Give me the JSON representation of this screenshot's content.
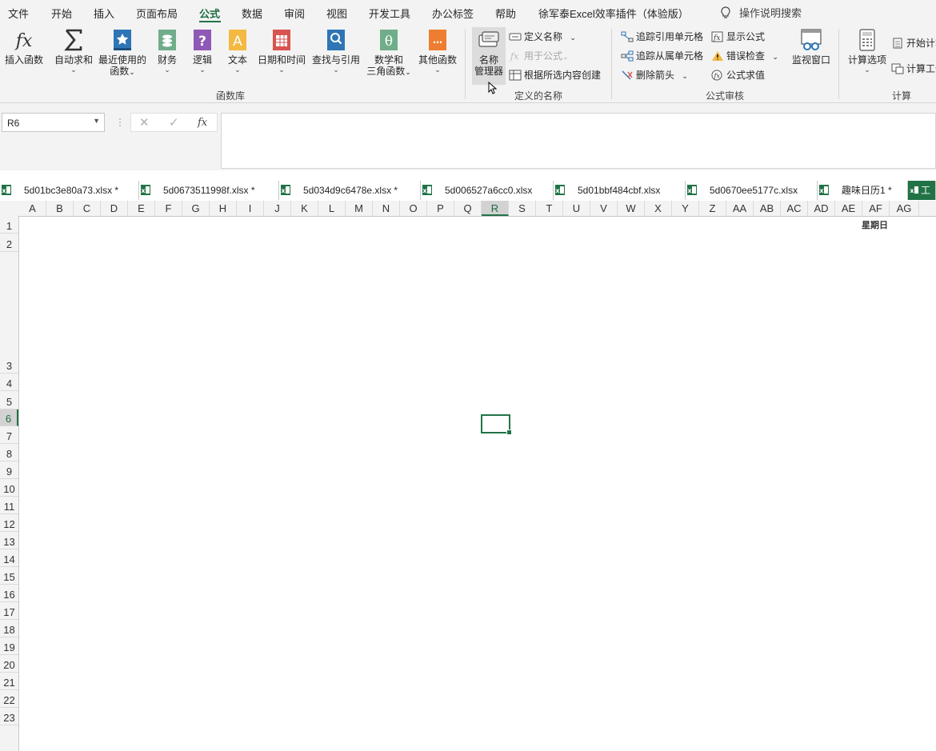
{
  "menu": {
    "items": [
      "文件",
      "开始",
      "插入",
      "页面布局",
      "公式",
      "数据",
      "审阅",
      "视图",
      "开发工具",
      "办公标签",
      "帮助",
      "徐军泰Excel效率插件（体验版）"
    ],
    "active": "公式",
    "tell_me": "操作说明搜索"
  },
  "ribbon": {
    "function_library": {
      "label": "函数库",
      "insert_function": "插入函数",
      "autosum": "自动求和",
      "recently_used": [
        "最近使用的",
        "函数"
      ],
      "financial": "财务",
      "logical": "逻辑",
      "text": "文本",
      "date_time": "日期和时间",
      "lookup": "查找与引用",
      "math": [
        "数学和",
        "三角函数"
      ],
      "more": "其他函数"
    },
    "defined_names": {
      "label": "定义的名称",
      "name_manager": [
        "名称",
        "管理器"
      ],
      "define_name": "定义名称",
      "use_in_formula": "用于公式",
      "create_from_selection": "根据所选内容创建"
    },
    "formula_auditing": {
      "label": "公式审核",
      "trace_precedents": "追踪引用单元格",
      "trace_dependents": "追踪从属单元格",
      "remove_arrows": "删除箭头",
      "show_formulas": "显示公式",
      "error_checking": "错误检查",
      "evaluate_formula": "公式求值",
      "watch_window": "监视窗口"
    },
    "calculation": {
      "label": "计算",
      "calc_options": "计算选项",
      "calc_now": "开始计算",
      "calc_sheet": "计算工作表"
    }
  },
  "formula_bar": {
    "name_box": "R6",
    "fx": "fx",
    "formula": ""
  },
  "workbook_tabs": [
    "5d01bc3e80a73.xlsx *",
    "5d0673511998f.xlsx *",
    "5d034d9c6478e.xlsx *",
    "5d006527a6cc0.xlsx",
    "5d01bbf484cbf.xlsx",
    "5d0670ee5177c.xlsx",
    "趣味日历1 *",
    "工"
  ],
  "columns": [
    "A",
    "B",
    "C",
    "D",
    "E",
    "F",
    "G",
    "H",
    "I",
    "J",
    "K",
    "L",
    "M",
    "N",
    "O",
    "P",
    "Q",
    "R",
    "S",
    "T",
    "U",
    "V",
    "W",
    "X",
    "Y",
    "Z",
    "AA",
    "AB",
    "AC",
    "AD",
    "AE",
    "AF",
    "AG"
  ],
  "selected_column": "R",
  "rows": [
    "1",
    "2",
    "3",
    "4",
    "5",
    "6",
    "7",
    "8",
    "9",
    "10",
    "11",
    "12",
    "13",
    "14",
    "15",
    "16",
    "17",
    "18",
    "19",
    "20",
    "21",
    "22",
    "23"
  ],
  "selected_row": "6",
  "cells": {
    "AF1": "星期日"
  },
  "colors": {
    "accent": "#217346",
    "ribbon_bg": "#f3f3f3"
  }
}
